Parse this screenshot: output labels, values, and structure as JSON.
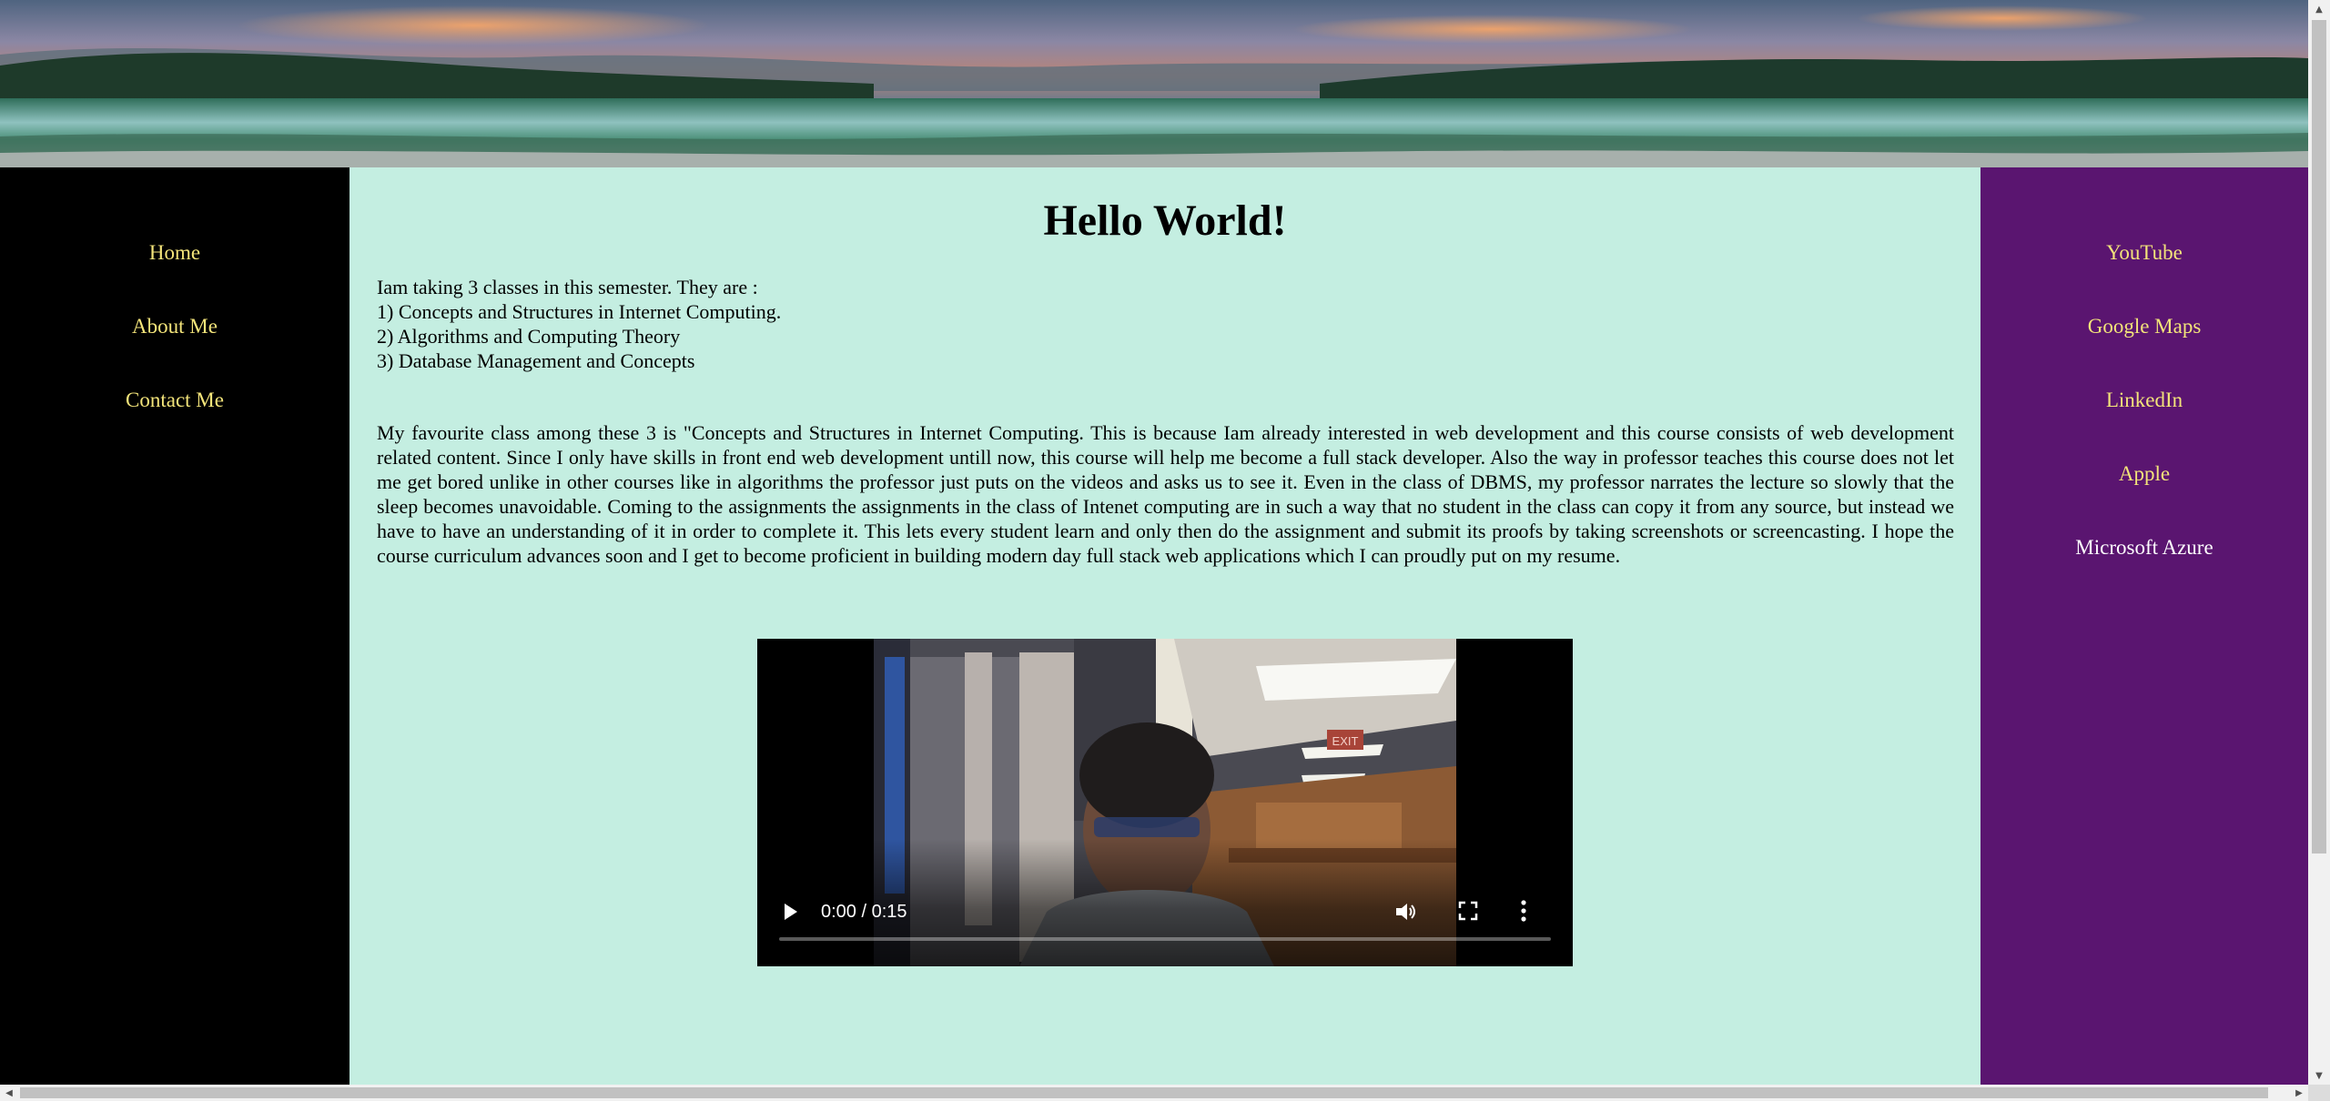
{
  "header": {
    "banner_image": "landscape-lake-sunset-banner"
  },
  "left_nav": {
    "items": [
      {
        "label": "Home"
      },
      {
        "label": "About Me"
      },
      {
        "label": "Contact Me"
      }
    ]
  },
  "main": {
    "title": "Hello World!",
    "classes_intro": "Iam taking 3 classes in this semester. They are :",
    "classes": [
      "1) Concepts and Structures in Internet Computing.",
      "2) Algorithms and Computing Theory",
      "3) Database Management and Concepts"
    ],
    "favourite_paragraph": "My favourite class among these 3 is \"Concepts and Structures in Internet Computing. This is because Iam already interested in web development and this course consists of web development related content. Since I only have skills in front end web development untill now, this course will help me become a full stack developer. Also the way in professor teaches this course does not let me get bored unlike in other courses like in algorithms the professor just puts on the videos and asks us to see it. Even in the class of DBMS, my professor narrates the lecture so slowly that the sleep becomes unavoidable. Coming to the assignments the assignments in the class of Intenet computing are in such a way that no student in the class can copy it from any source, but instead we have to have an understanding of it in order to complete it. This lets every student learn and only then do the assignment and submit its proofs by taking screenshots or screencasting. I hope the course curriculum advances soon and I get to become proficient in building modern day full stack web applications which I can proudly put on my resume.",
    "video": {
      "time_display": "0:00 / 0:15",
      "progress": 0,
      "exit_sign": "EXIT",
      "icons": {
        "play": "play-icon",
        "volume": "volume-icon",
        "fullscreen": "fullscreen-icon",
        "more": "more-options-icon"
      }
    }
  },
  "right_nav": {
    "items": [
      {
        "label": "YouTube"
      },
      {
        "label": "Google Maps"
      },
      {
        "label": "LinkedIn"
      },
      {
        "label": "Apple"
      },
      {
        "label": "Microsoft Azure"
      }
    ]
  },
  "colors": {
    "left_nav_bg": "#000000",
    "main_bg": "#c4eee1",
    "right_nav_bg": "#5a1570",
    "link_color": "#f3e47a",
    "visited_link_color": "#ffffff"
  }
}
